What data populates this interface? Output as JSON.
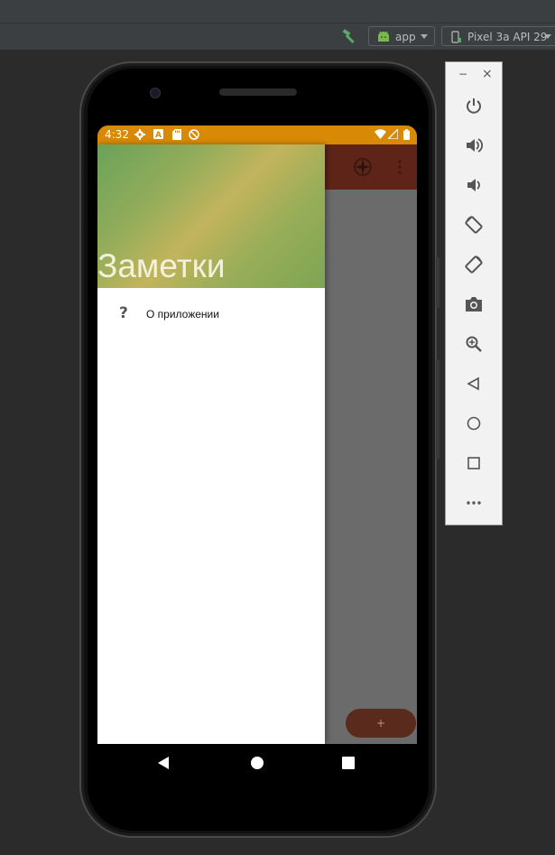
{
  "ide": {
    "run_config": "app",
    "device": "Pixel 3a API 29"
  },
  "statusbar": {
    "time": "4:32"
  },
  "drawer": {
    "title": "Заметки",
    "items": [
      {
        "icon": "question-mark-icon",
        "glyph": "?",
        "label": "О приложении"
      }
    ]
  },
  "fab": {
    "label": "+"
  },
  "colors": {
    "statusbar": "#d88a06",
    "app_toolbar": "#5f2418",
    "fab": "#5a2a1c",
    "drawer_header_start": "#6aa25a",
    "drawer_header_mid": "#c2b45c"
  },
  "emulator_controls": [
    "power-icon",
    "volume-up-icon",
    "volume-down-icon",
    "rotate-left-icon",
    "rotate-right-icon",
    "camera-icon",
    "zoom-icon",
    "back-icon",
    "home-icon",
    "overview-icon",
    "more-icon"
  ],
  "emulator_window": {
    "minimize": "−",
    "close": "×"
  }
}
